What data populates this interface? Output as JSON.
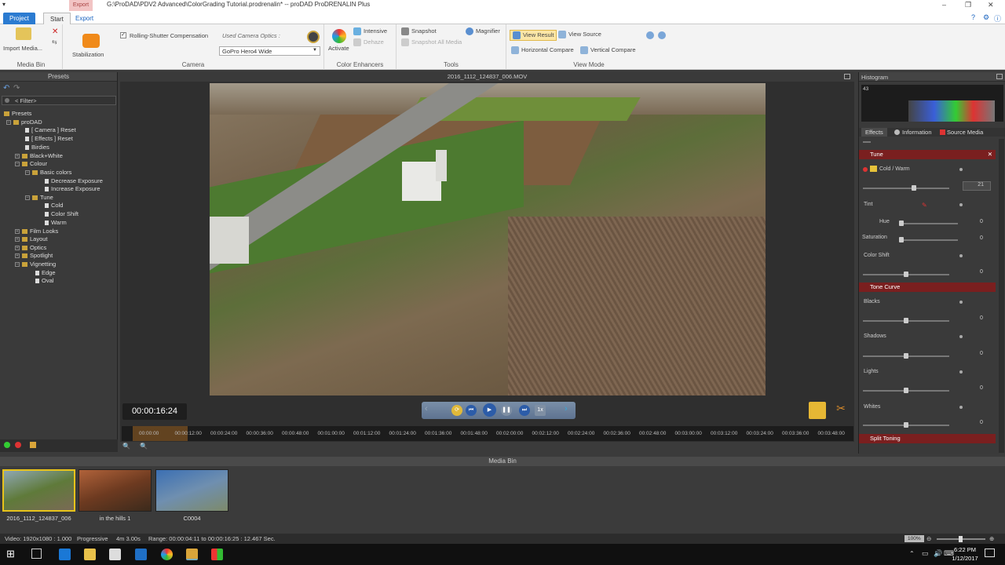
{
  "window": {
    "title": "G:\\ProDAD\\PDV2 Advanced\\ColorGrading Tutorial.prodrenalin* -- proDAD ProDRENALIN Plus",
    "highlight_tab": "Export"
  },
  "tabs": [
    {
      "label": "Project"
    },
    {
      "label": "Start"
    },
    {
      "label": "Export"
    }
  ],
  "ribbon": {
    "media_bin": {
      "import_label": "Import Media...",
      "group_label": "Media Bin"
    },
    "camera": {
      "stabilization_label": "Stabilization",
      "rolling_shutter_label": "Rolling-Shutter Compensation",
      "used_camera_label": "Used Camera Optics :",
      "camera_value": "GoPro Hero4 Wide",
      "group_label": "Camera"
    },
    "color_enhancers": {
      "activate_label": "Activate",
      "intensive_label": "Intensive",
      "dehaze_label": "Dehaze",
      "group_label": "Color Enhancers"
    },
    "tools": {
      "snapshot_label": "Snapshot",
      "magnifier_label": "Magnifier",
      "snapshot_all_label": "Snapshot All Media",
      "group_label": "Tools"
    },
    "view_mode": {
      "view_result_label": "View Result",
      "view_source_label": "View Source",
      "horizontal_label": "Horizontal Compare",
      "vertical_label": "Vertical Compare",
      "group_label": "View Mode"
    }
  },
  "presets_panel": {
    "title": "Presets",
    "filter": "< Filter>",
    "tree": [
      {
        "label": "Presets"
      },
      {
        "label": "proDAD"
      },
      {
        "label": "[ Camera ]  Reset"
      },
      {
        "label": "[ Effects ]  Reset"
      },
      {
        "label": "Birdies"
      },
      {
        "label": "Black+White"
      },
      {
        "label": "Colour"
      },
      {
        "label": "Basic colors"
      },
      {
        "label": "Decrease Exposure"
      },
      {
        "label": "Increase Exposure"
      },
      {
        "label": "Tune"
      },
      {
        "label": "Cold"
      },
      {
        "label": "Color Shift"
      },
      {
        "label": "Warm"
      },
      {
        "label": "Film Looks"
      },
      {
        "label": "Layout"
      },
      {
        "label": "Optics"
      },
      {
        "label": "Spotlight"
      },
      {
        "label": "Vignetting"
      },
      {
        "label": "Edge"
      },
      {
        "label": "Oval"
      }
    ]
  },
  "preview": {
    "filename": "2016_1112_124837_006.MOV",
    "timecode": "00:00:16:24",
    "speed_label": "1x"
  },
  "timeline": {
    "ticks": [
      "00:00:00",
      "00:00:12:00",
      "00:00:24:00",
      "00:00:36:00",
      "00:00:48:00",
      "00:01:00:00",
      "00:01:12:00",
      "00:01:24:00",
      "00:01:36:00",
      "00:01:48:00",
      "00:02:00:00",
      "00:02:12:00",
      "00:02:24:00",
      "00:02:36:00",
      "00:02:48:00",
      "00:03:00:00",
      "00:03:12:00",
      "00:03:24:00",
      "00:03:36:00",
      "00:03:48:00"
    ]
  },
  "right_panel": {
    "histogram_title": "Histogram",
    "histogram_value": "43",
    "tabs": [
      "Effects",
      "Information",
      "Source Media"
    ],
    "tune_section": "Tune",
    "cold_warm_label": "Cold / Warm",
    "cold_warm_value": "21",
    "tint_label": "Tint",
    "hue_label": "Hue",
    "hue_value": "0",
    "saturation_label": "Saturation",
    "saturation_value": "0",
    "color_shift_label": "Color Shift",
    "color_shift_value": "0",
    "tone_curve_section": "Tone Curve",
    "blacks_label": "Blacks",
    "blacks_value": "0",
    "shadows_label": "Shadows",
    "shadows_value": "0",
    "lights_label": "Lights",
    "lights_value": "0",
    "whites_label": "Whites",
    "whites_value": "0",
    "split_toning_section": "Split Toning"
  },
  "media_bin": {
    "title": "Media Bin",
    "items": [
      {
        "caption": "2016_1112_124837_006"
      },
      {
        "caption": "in the hills 1"
      },
      {
        "caption": "C0004"
      }
    ]
  },
  "status": {
    "video": "Video: 1920x1080 : 1.000",
    "scan": "Progressive",
    "duration": "4m 3.00s",
    "range": "Range: 00:00:04:11 to 00:00:16:25 : 12.467 Sec.",
    "zoom": "100%"
  },
  "taskbar": {
    "time": "6:22 PM",
    "date": "1/12/2017"
  }
}
